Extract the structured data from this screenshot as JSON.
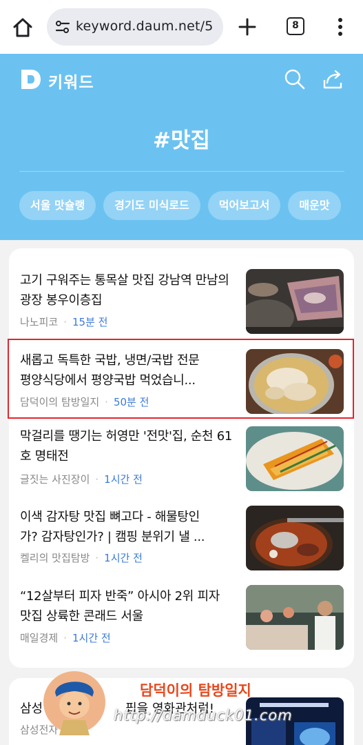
{
  "browser": {
    "url": "keyword.daum.net/5",
    "tab_count": "8",
    "home_icon": "home-icon",
    "tune_icon": "tune-icon",
    "new_tab_icon": "plus-icon",
    "menu_icon": "more-vert-icon"
  },
  "header": {
    "brand": "키워드",
    "hashtag": "#맛집",
    "chips": [
      "서울 맛슐랭",
      "경기도 미식로드",
      "먹어보고서",
      "매운맛"
    ],
    "colors": {
      "background": "#6bc2f1",
      "text": "#ffffff"
    }
  },
  "articles": [
    {
      "title": "고기 구워주는 통목살 맛집 강남역 만남의 광장 봉우이층집",
      "source": "나노피코",
      "time": "15분 전"
    },
    {
      "title": "새롭고 독특한 국밥, 냉면/국밥 전문 평양식당에서 평양국밥 먹었습니...",
      "title_line1": "새롭고 독특한 국밥, 냉면/국밥 전문",
      "title_line2": "평양식당에서 평양국밥 먹었습니...",
      "source": "담덕이의 탐방일지",
      "time": "50분 전",
      "highlighted": true
    },
    {
      "title": "막걸리를 땡기는 허영만 '전맛'집, 순천 61호 명태전",
      "source": "글짓는 사진장이",
      "time": "1시간 전"
    },
    {
      "title": "이색 감자탕 맛집 뼈고다 - 해물탕인가? 감자탕인가? | 캠핑 분위기 낼 ...",
      "title_line1": "이색 감자탕 맛집 뼈고다 - 해물탕인",
      "title_line2": "가? 감자탕인가? | 캠핑 분위기 낼 ...",
      "source": "켈리의 맛집탐방",
      "time": "1시간 전"
    },
    {
      "title": "“12살부터 피자 반죽” 아시아 2위 피자 맛집 상륙한 콘래드 서울",
      "source": "매일경제",
      "time": "1시간 전"
    }
  ],
  "next_card": {
    "title_left": "삼성",
    "title_right": "핍을 영화관처럼!",
    "source": "삼성전자"
  },
  "watermark": {
    "name": "담덕이의 탐방일지",
    "url": "http://damduck01.com"
  },
  "colors": {
    "highlight_border": "#e3242b",
    "time": "#3b7ad8",
    "meta": "#888888"
  }
}
